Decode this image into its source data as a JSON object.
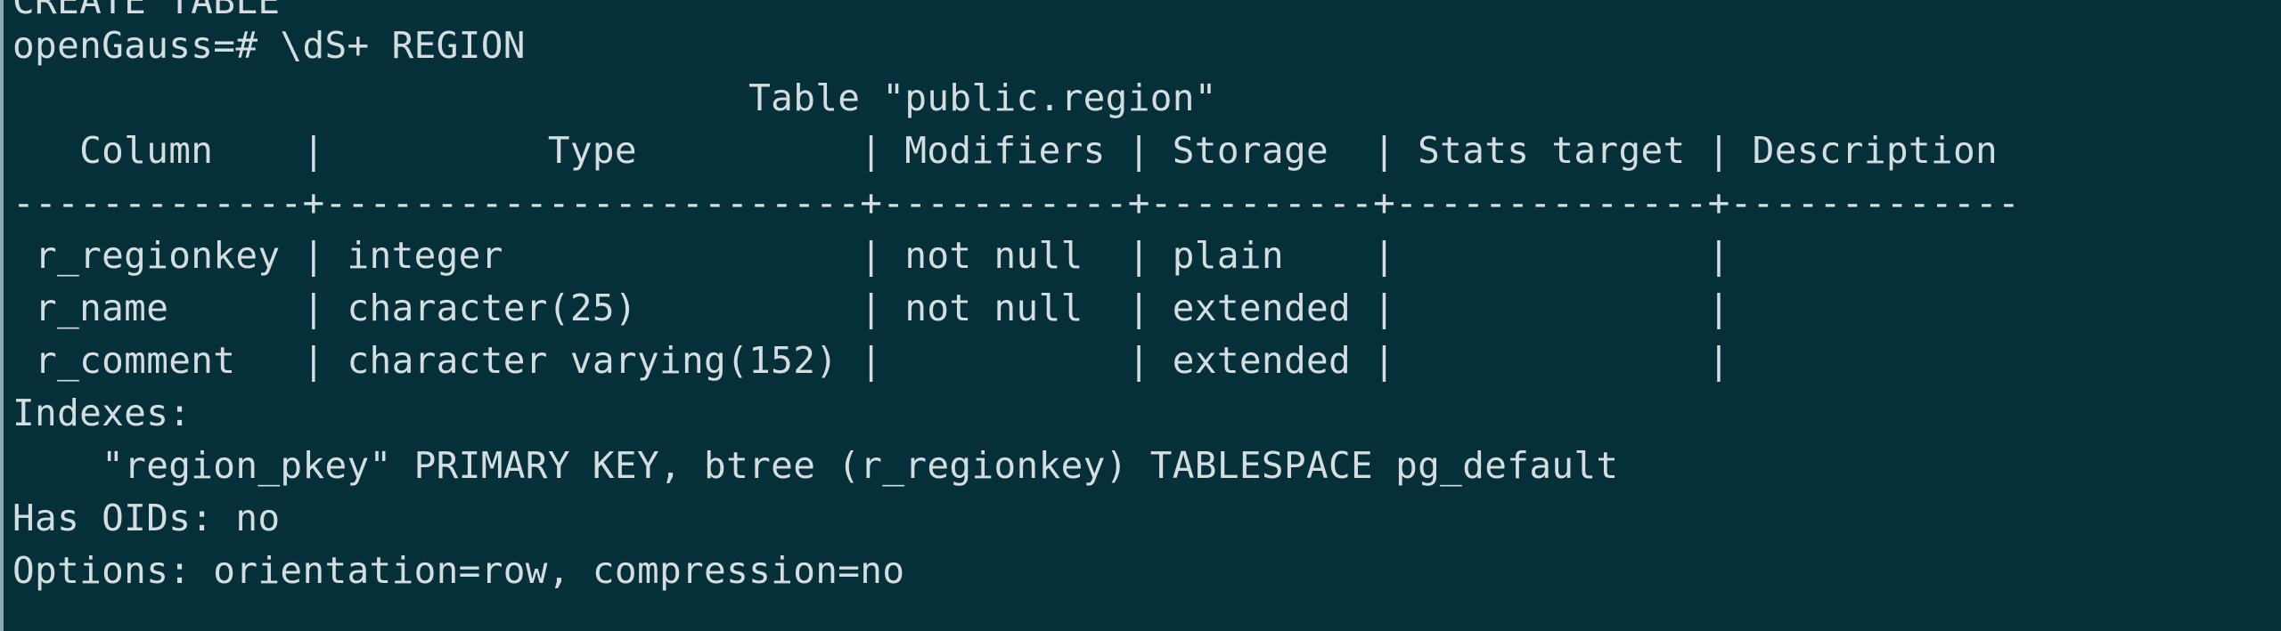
{
  "terminal": {
    "lines": [
      "CREATE TABLE",
      "openGauss=# \\dS+ REGION",
      "                                 Table \"public.region\"",
      "   Column    |          Type          | Modifiers | Storage  | Stats target | Description",
      "-------------+------------------------+-----------+----------+--------------+-------------",
      " r_regionkey | integer                | not null  | plain    |              |",
      " r_name      | character(25)          | not null  | extended |              |",
      " r_comment   | character varying(152) |           | extended |              |",
      "Indexes:",
      "    \"region_pkey\" PRIMARY KEY, btree (r_regionkey) TABLESPACE pg_default",
      "Has OIDs: no",
      "Options: orientation=row, compression=no"
    ]
  }
}
